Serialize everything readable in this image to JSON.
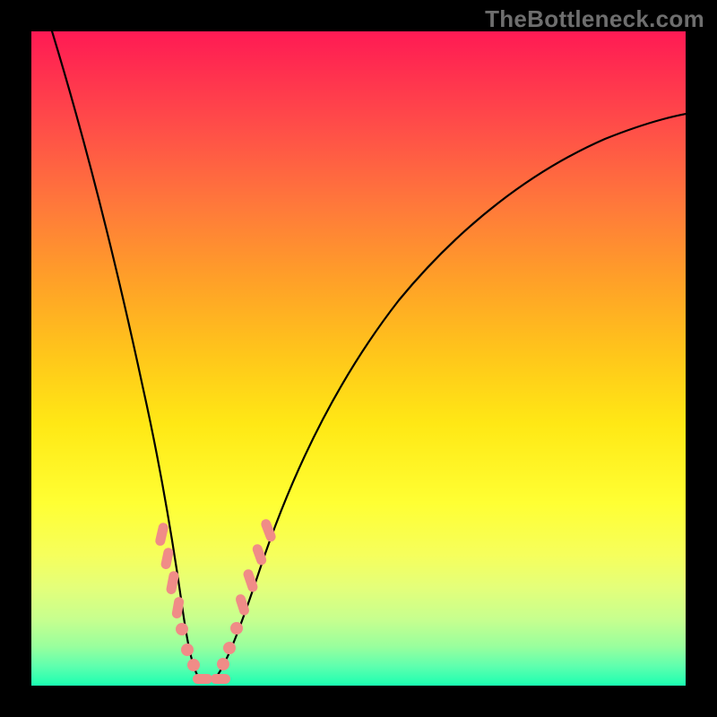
{
  "watermark": "TheBottleneck.com",
  "colors": {
    "gradient_top": "#ff1a54",
    "gradient_bottom": "#1bffb1",
    "curve": "#000000",
    "markers": "#f08c87",
    "frame": "#000000"
  },
  "chart_data": {
    "type": "line",
    "title": "",
    "xlabel": "",
    "ylabel": "",
    "xlim": [
      0,
      100
    ],
    "ylim": [
      0,
      100
    ],
    "grid": false,
    "legend": false,
    "series": [
      {
        "name": "bottleneck-curve",
        "description": "V-shaped curve: steep descent from top-left to a minimum near x≈24, then asymptotic rise toward top-right",
        "x": [
          3,
          6,
          9,
          12,
          15,
          17,
          19,
          20,
          21,
          22,
          23,
          24,
          25,
          26,
          27,
          28,
          30,
          33,
          37,
          42,
          50,
          60,
          72,
          86,
          100
        ],
        "y": [
          100,
          84,
          70,
          56,
          43,
          34,
          26,
          21,
          17,
          12,
          7,
          3,
          2,
          3,
          6,
          10,
          18,
          28,
          39,
          49,
          61,
          71,
          79,
          85,
          89
        ]
      }
    ],
    "markers": {
      "description": "Highlighted points along the curve near its minimum (render as small rounded pills)",
      "points": [
        {
          "x": 19.5,
          "y": 24
        },
        {
          "x": 20.0,
          "y": 21
        },
        {
          "x": 20.7,
          "y": 17
        },
        {
          "x": 21.3,
          "y": 13
        },
        {
          "x": 22.0,
          "y": 9
        },
        {
          "x": 22.8,
          "y": 6
        },
        {
          "x": 23.5,
          "y": 3.5
        },
        {
          "x": 24.4,
          "y": 2.2
        },
        {
          "x": 25.3,
          "y": 2.3
        },
        {
          "x": 26.2,
          "y": 3.5
        },
        {
          "x": 27.0,
          "y": 6
        },
        {
          "x": 27.8,
          "y": 9
        },
        {
          "x": 28.7,
          "y": 13
        },
        {
          "x": 29.6,
          "y": 17
        },
        {
          "x": 30.6,
          "y": 21
        },
        {
          "x": 31.5,
          "y": 24
        }
      ]
    }
  }
}
